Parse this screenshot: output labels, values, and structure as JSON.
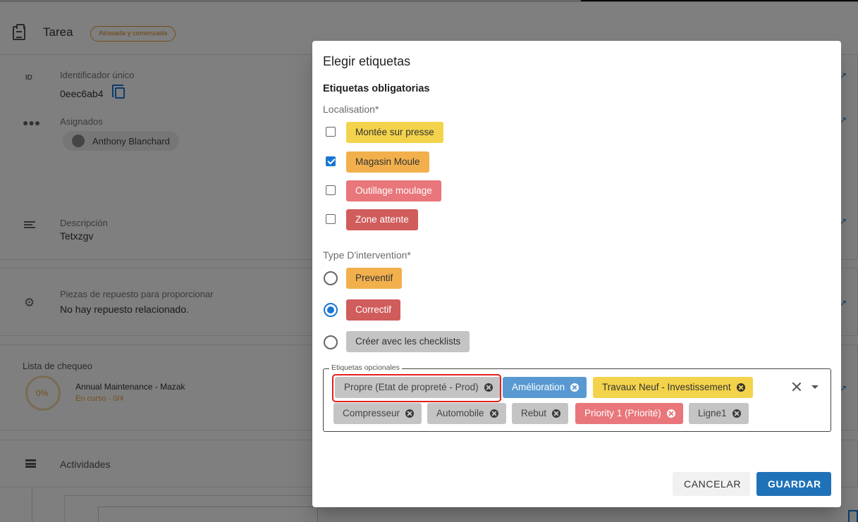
{
  "background": {
    "task_title": "Tarea",
    "task_status": "Atrasada y comenzada",
    "id_label": "Identificador único",
    "id_value": "0eec6ab4",
    "assignees_label": "Asignados",
    "assignee_name": "Anthony Blanchard",
    "description_label": "Descripción",
    "description_value": "Tetxzgv",
    "spare_parts_label": "Piezas de repuesto para proporcionar",
    "spare_parts_value": "No hay repuesto relacionado.",
    "checklist_label": "Lista de chequeo",
    "checklist_progress": "0%",
    "checklist_name": "Annual Maintenance - Mazak",
    "checklist_status": "En curso - 0/4",
    "activities_label": "Actividades",
    "id_icon_text": "ID"
  },
  "dialog": {
    "title": "Elegir etiquetas",
    "mandatory_section": "Etiquetas obligatorias",
    "localisation_label": "Localisation*",
    "localisation_options": [
      {
        "label": "Montée sur presse",
        "checked": false,
        "color": "#f3d34b"
      },
      {
        "label": "Magasin Moule",
        "checked": true,
        "color": "#f2b04d"
      },
      {
        "label": "Outillage moulage",
        "checked": false,
        "color": "#e8767a"
      },
      {
        "label": "Zone attente",
        "checked": false,
        "color": "#d05c5c"
      }
    ],
    "intervention_label": "Type D'intervention*",
    "intervention_options": [
      {
        "label": "Preventif",
        "checked": false,
        "color": "#f2b04d"
      },
      {
        "label": "Correctif",
        "checked": true,
        "color": "#d05c5c"
      },
      {
        "label": "Créer avec les checklists",
        "checked": false,
        "color": "#c4c4c4"
      }
    ],
    "optional_label": "Etiquetas opcionales",
    "optional_chips": [
      {
        "label": "Propre (Etat de propreté - Prod)",
        "color": "gray",
        "highlighted": true
      },
      {
        "label": "Amélioration",
        "color": "blue"
      },
      {
        "label": "Travaux Neuf - Investissement",
        "color": "yellow"
      },
      {
        "label": "Compresseur",
        "color": "gray"
      },
      {
        "label": "Automobile",
        "color": "gray"
      },
      {
        "label": "Rebut",
        "color": "gray"
      },
      {
        "label": "Priority 1 (Priorité)",
        "color": "red"
      },
      {
        "label": "Ligne1",
        "color": "gray"
      }
    ],
    "cancel_label": "CANCELAR",
    "save_label": "GUARDAR",
    "accent_color": "#1976d2",
    "highlight_color": "#e02020"
  }
}
